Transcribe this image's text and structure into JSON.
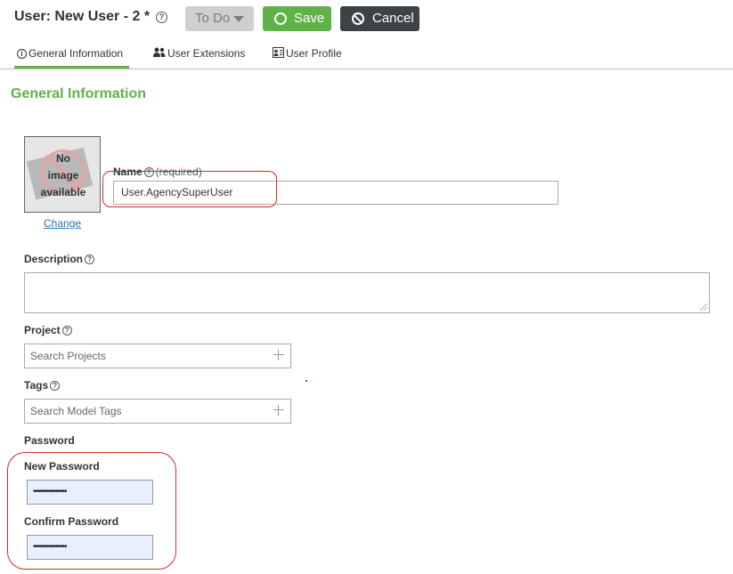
{
  "header": {
    "title": "User: New User - 2 *",
    "help_glyph": "?",
    "status_button": "To Do",
    "save_label": "Save",
    "cancel_label": "Cancel"
  },
  "tabs": [
    {
      "label": "General Information",
      "icon": "info-icon",
      "active": true
    },
    {
      "label": "User Extensions",
      "icon": "users-icon",
      "active": false
    },
    {
      "label": "User Profile",
      "icon": "profile-card-icon",
      "active": false
    }
  ],
  "section": {
    "title": "General Information"
  },
  "photo": {
    "placeholder_lines": [
      "No",
      "image",
      "available"
    ],
    "change_label": "Change"
  },
  "form": {
    "name": {
      "label": "Name",
      "required_note": "(required)",
      "value": "User.AgencySuperUser"
    },
    "description": {
      "label": "Description",
      "value": ""
    },
    "project": {
      "label": "Project",
      "placeholder": "Search Projects"
    },
    "tags": {
      "label": "Tags",
      "placeholder": "Search Model Tags"
    },
    "password": {
      "heading": "Password",
      "new_label": "New Password",
      "new_value": "•••••••••••••••",
      "confirm_label": "Confirm Password",
      "confirm_value": "•••••••••••••••"
    }
  },
  "colors": {
    "accent_green": "#5fb248",
    "cancel_dark": "#3d4245",
    "todo_gray": "#cfcfcf",
    "link_blue": "#2a6fb0",
    "highlight_red": "#d42a2a",
    "autofill_blue": "#e8f0fe"
  }
}
